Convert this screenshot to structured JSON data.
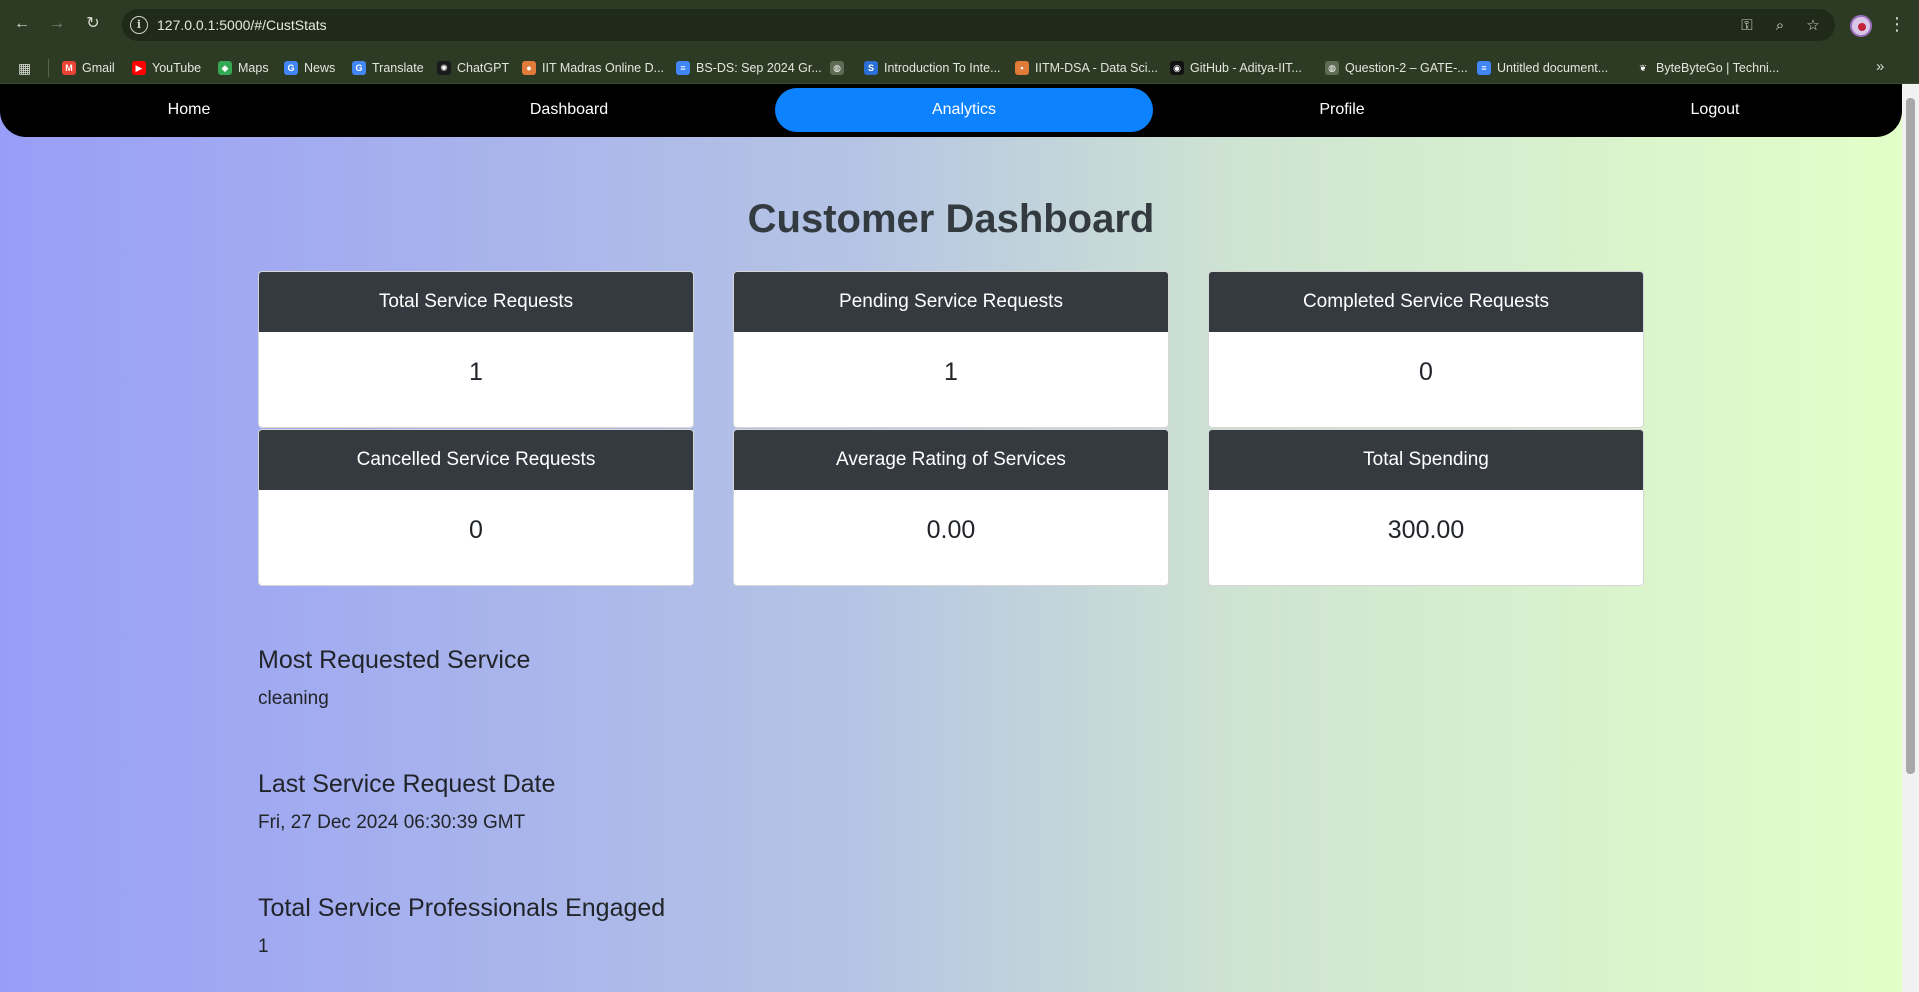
{
  "browser": {
    "url": "127.0.0.1:5000/#/CustStats",
    "bookmarks": [
      {
        "label": "Gmail",
        "icon": "gmail-icon",
        "color": "#ea4335",
        "glyph": "M"
      },
      {
        "label": "YouTube",
        "icon": "youtube-icon",
        "color": "#ff0000",
        "glyph": "▶"
      },
      {
        "label": "Maps",
        "icon": "maps-icon",
        "color": "#34a853",
        "glyph": "◆"
      },
      {
        "label": "News",
        "icon": "news-icon",
        "color": "#4285f4",
        "glyph": "G"
      },
      {
        "label": "Translate",
        "icon": "translate-icon",
        "color": "#4285f4",
        "glyph": "G"
      },
      {
        "label": "ChatGPT",
        "icon": "chatgpt-icon",
        "color": "#1a1a1a",
        "glyph": "✺"
      },
      {
        "label": "IIT Madras Online D...",
        "icon": "iitm-icon",
        "color": "#e07b39",
        "glyph": "●"
      },
      {
        "label": "BS-DS: Sep 2024 Gr...",
        "icon": "docs-icon",
        "color": "#4285f4",
        "glyph": "≡"
      },
      {
        "label": "",
        "icon": "globe-icon",
        "color": "#5f6b55",
        "glyph": "◍"
      },
      {
        "label": "Introduction To Inte...",
        "icon": "swayam-icon",
        "color": "#2b6fd6",
        "glyph": "S"
      },
      {
        "label": "IITM-DSA - Data Sci...",
        "icon": "dot-icon",
        "color": "#e07b39",
        "glyph": "•"
      },
      {
        "label": "GitHub - Aditya-IIT...",
        "icon": "github-icon",
        "color": "#111111",
        "glyph": "◉"
      },
      {
        "label": "Question-2 – GATE-...",
        "icon": "globe-icon",
        "color": "#5f6b55",
        "glyph": "◍"
      },
      {
        "label": "Untitled document...",
        "icon": "docs-icon",
        "color": "#4285f4",
        "glyph": "≡"
      },
      {
        "label": "ByteByteGo | Techni...",
        "icon": "bytebytego-icon",
        "color": "#2e3b24",
        "glyph": "❦"
      }
    ]
  },
  "navbar": {
    "items": [
      {
        "label": "Home",
        "active": false
      },
      {
        "label": "Dashboard",
        "active": false
      },
      {
        "label": "Analytics",
        "active": true
      },
      {
        "label": "Profile",
        "active": false
      },
      {
        "label": "Logout",
        "active": false
      }
    ],
    "active_color": "#0d82ff"
  },
  "main": {
    "title": "Customer Dashboard",
    "cards": [
      {
        "header": "Total Service Requests",
        "value": "1"
      },
      {
        "header": "Pending Service Requests",
        "value": "1"
      },
      {
        "header": "Completed Service Requests",
        "value": "0"
      },
      {
        "header": "Cancelled Service Requests",
        "value": "0"
      },
      {
        "header": "Average Rating of Services",
        "value": "0.00"
      },
      {
        "header": "Total Spending",
        "value": "300.00"
      }
    ],
    "sections": [
      {
        "heading": "Most Requested Service",
        "value": "cleaning"
      },
      {
        "heading": "Last Service Request Date",
        "value": "Fri, 27 Dec 2024 06:30:39 GMT"
      },
      {
        "heading": "Total Service Professionals Engaged",
        "value": "1"
      }
    ]
  }
}
